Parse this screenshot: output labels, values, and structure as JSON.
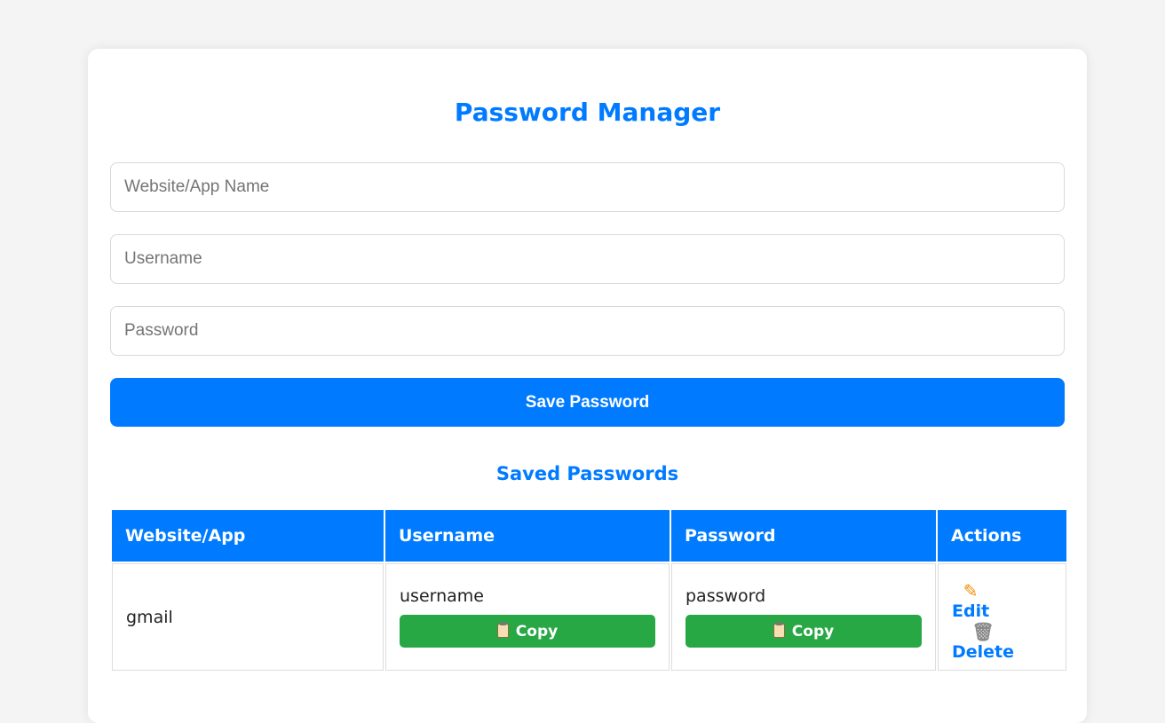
{
  "header": {
    "title": "Password Manager"
  },
  "form": {
    "website_placeholder": "Website/App Name",
    "username_placeholder": "Username",
    "password_placeholder": "Password",
    "save_label": "Save Password"
  },
  "saved": {
    "title": "Saved Passwords",
    "columns": [
      "Website/App",
      "Username",
      "Password",
      "Actions"
    ],
    "rows": [
      {
        "website": "gmail",
        "username": "username",
        "password": "password",
        "copy_label": "Copy",
        "edit_label": "Edit",
        "delete_label": "Delete"
      }
    ]
  },
  "icons": {
    "copy": "clipboard-icon",
    "edit": "pencil-icon",
    "delete": "trash-icon"
  },
  "colors": {
    "accent": "#007bff",
    "copy_button": "#28a745",
    "background": "#f4f4f4"
  }
}
